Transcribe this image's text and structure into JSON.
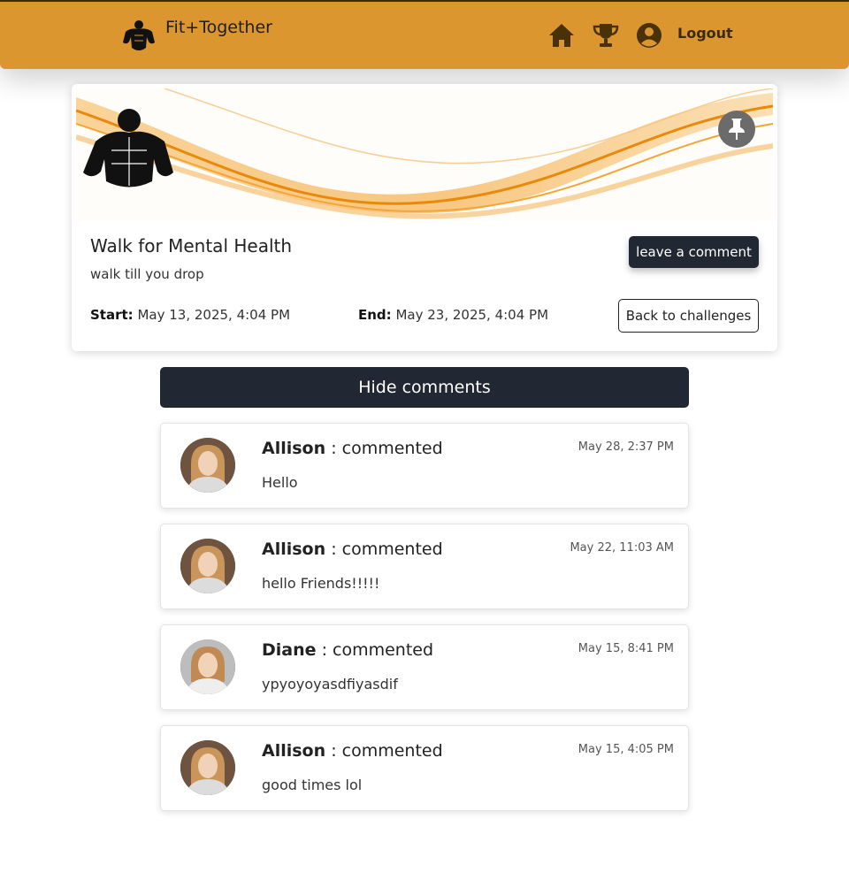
{
  "nav": {
    "brand": "Fit+Together",
    "logout": "Logout",
    "icons": [
      "home-icon",
      "trophy-icon",
      "user-circle-icon"
    ]
  },
  "challenge": {
    "title": "Walk for Mental Health",
    "description": "walk till you drop",
    "start_label": "Start:",
    "start_value": "May 13, 2025, 4:04 PM",
    "end_label": "End:",
    "end_value": "May 23, 2025, 4:04 PM",
    "leave_comment": "leave a comment",
    "back": "Back to challenges"
  },
  "comments_toggle": "Hide comments",
  "comments": [
    {
      "author": "Allison",
      "suffix": ": commented",
      "time": "May 28, 2:37 PM",
      "text": "Hello"
    },
    {
      "author": "Allison",
      "suffix": ": commented",
      "time": "May 22, 11:03 AM",
      "text": "hello Friends!!!!!"
    },
    {
      "author": "Diane",
      "suffix": ": commented",
      "time": "May 15, 8:41 PM",
      "text": "ypyoyoyasdfiyasdif"
    },
    {
      "author": "Allison",
      "suffix": ": commented",
      "time": "May 15, 4:05 PM",
      "text": "good times lol"
    }
  ],
  "colors": {
    "nav_bg": "#dc962f",
    "dark_button": "#212833",
    "accent_orange": "#f0a030"
  }
}
